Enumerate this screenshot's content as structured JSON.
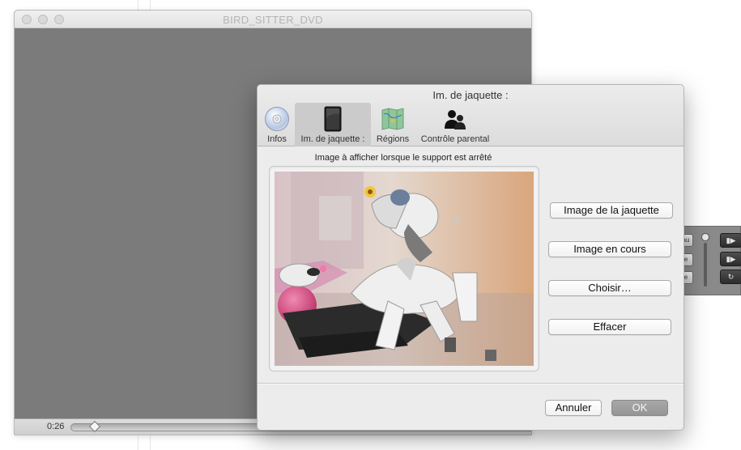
{
  "player": {
    "title": "BIRD_SITTER_DVD",
    "time": "0:26"
  },
  "remote": {
    "btn_labels": [
      "au",
      "e",
      "e"
    ],
    "dark_btns": [
      "▮▶",
      "▮▶",
      "↻"
    ]
  },
  "dialog": {
    "title": "Im. de jaquette :",
    "tabs": [
      {
        "label": "Infos",
        "icon": "dvd-disc-icon"
      },
      {
        "label": "Im. de jaquette :",
        "icon": "jacket-image-icon"
      },
      {
        "label": "Régions",
        "icon": "region-map-icon"
      },
      {
        "label": "Contrôle parental",
        "icon": "parental-control-icon"
      }
    ],
    "caption": "Image à afficher lorsque le support est arrêté",
    "buttons": {
      "jacket": "Image de la jaquette",
      "current": "Image en cours",
      "choose": "Choisir…",
      "clear": "Effacer",
      "cancel": "Annuler",
      "ok": "OK"
    }
  }
}
